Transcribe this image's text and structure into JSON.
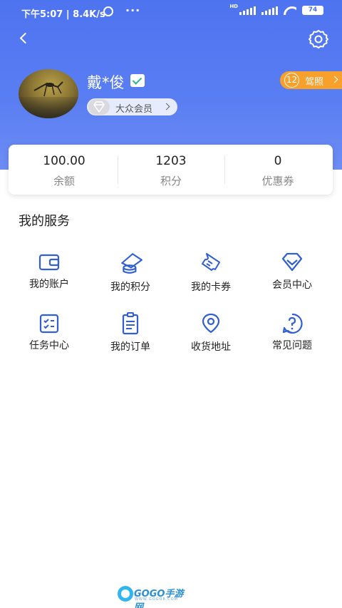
{
  "status_bar": {
    "time": "下午5:07",
    "speed": "| 8.4K/s",
    "dots": "···",
    "network_badge": "HD",
    "battery": "74"
  },
  "header": {
    "username": "戴*俊",
    "member_level": "大众会员",
    "license_count": "12",
    "license_label": "驾照"
  },
  "stats": [
    {
      "value": "100.00",
      "label": "余额"
    },
    {
      "value": "1203",
      "label": "积分"
    },
    {
      "value": "0",
      "label": "优惠券"
    }
  ],
  "services": {
    "title": "我的服务",
    "items": [
      {
        "label": "我的账户",
        "icon": "wallet-icon"
      },
      {
        "label": "我的积分",
        "icon": "points-icon"
      },
      {
        "label": "我的卡券",
        "icon": "ticket-icon"
      },
      {
        "label": "会员中心",
        "icon": "diamond-icon"
      },
      {
        "label": "任务中心",
        "icon": "checklist-icon"
      },
      {
        "label": "我的订单",
        "icon": "order-clipboard-icon"
      },
      {
        "label": "收货地址",
        "icon": "location-pin-icon"
      },
      {
        "label": "常见问题",
        "icon": "question-icon"
      }
    ]
  },
  "watermark": {
    "brand": "GOGO手游网",
    "domain": "WWW.GOGO8.COM"
  },
  "colors": {
    "header_blue": "#4e73f0",
    "icon_blue": "#2f5fd3",
    "license_orange": "#f7a12c",
    "verified_green": "#28b98a"
  }
}
